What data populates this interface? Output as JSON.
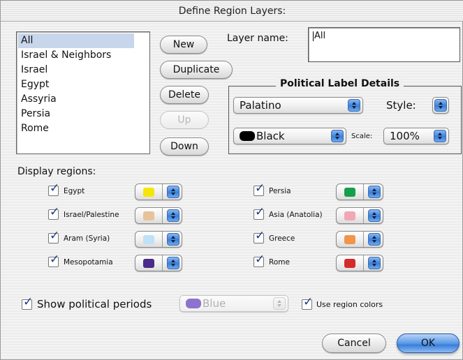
{
  "window": {
    "title": "Define Region Layers:"
  },
  "layers": {
    "items": [
      "All",
      "Israel & Neighbors",
      "Israel",
      "Egypt",
      "Assyria",
      "Persia",
      "Rome"
    ],
    "selected": "All"
  },
  "buttons": {
    "new": "New",
    "duplicate": "Duplicate",
    "delete": "Delete",
    "up": "Up",
    "down": "Down",
    "cancel": "Cancel",
    "ok": "OK"
  },
  "layer_name": {
    "label": "Layer name:",
    "value": "All"
  },
  "political_label": {
    "title": "Political Label Details",
    "font": "Palatino",
    "style_label": "Style:",
    "color": "Black",
    "color_hex": "#000000",
    "scale_label": "Scale:",
    "scale": "100%"
  },
  "display_regions": {
    "label": "Display regions:",
    "left": [
      {
        "name": "Egypt",
        "checked": true,
        "color": "#f5e60a"
      },
      {
        "name": "Israel/Palestine",
        "checked": true,
        "color": "#e6c39a"
      },
      {
        "name": "Aram (Syria)",
        "checked": true,
        "color": "#bfe1f7"
      },
      {
        "name": "Mesopotamia",
        "checked": true,
        "color": "#4a2a8a"
      }
    ],
    "right": [
      {
        "name": "Persia",
        "checked": true,
        "color": "#14a04a"
      },
      {
        "name": "Asia (Anatolia)",
        "checked": true,
        "color": "#f2a7b4"
      },
      {
        "name": "Greece",
        "checked": true,
        "color": "#f0954a"
      },
      {
        "name": "Rome",
        "checked": true,
        "color": "#d42a2a"
      }
    ]
  },
  "political_periods": {
    "show_label": "Show political periods",
    "show_checked": true,
    "color": "Blue",
    "color_hex": "#7a5cc6",
    "use_region_colors_label": "Use region colors",
    "use_region_colors_checked": true
  }
}
